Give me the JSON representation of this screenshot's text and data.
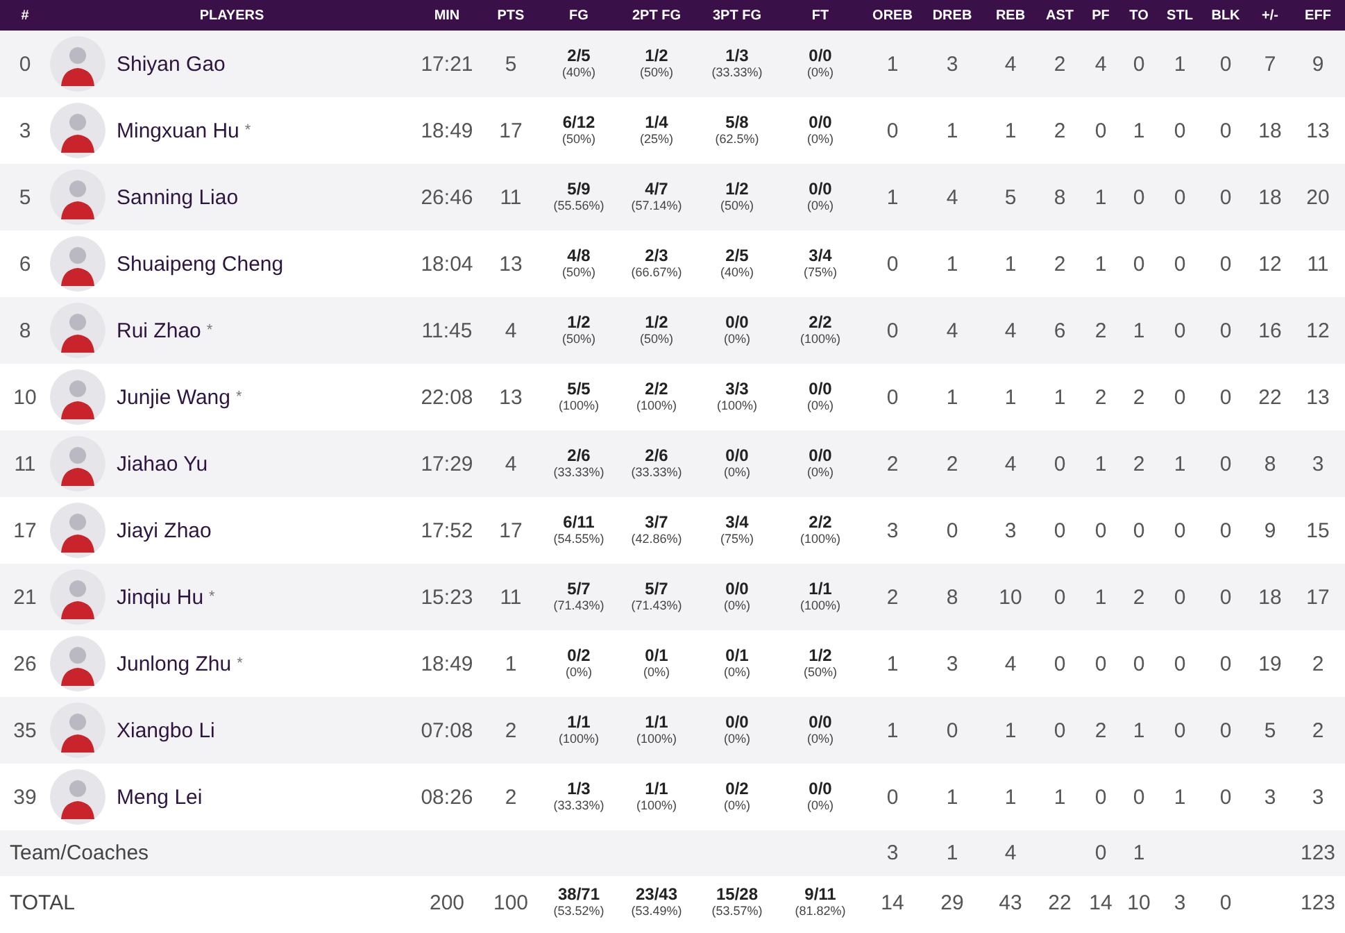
{
  "columns": [
    "#",
    "PLAYERS",
    "MIN",
    "PTS",
    "FG",
    "2PT FG",
    "3PT FG",
    "FT",
    "OREB",
    "DREB",
    "REB",
    "AST",
    "PF",
    "TO",
    "STL",
    "BLK",
    "+/-",
    "EFF"
  ],
  "players": [
    {
      "no": "0",
      "name": "Shiyan Gao",
      "min": "17:21",
      "pts": "5",
      "shots": [
        [
          "2/5",
          "(40%)"
        ],
        [
          "1/2",
          "(50%)"
        ],
        [
          "1/3",
          "(33.33%)"
        ],
        [
          "0/0",
          "(0%)"
        ]
      ],
      "stats": [
        "1",
        "3",
        "4",
        "2",
        "4",
        "0",
        "1",
        "0",
        "7",
        "9"
      ]
    },
    {
      "no": "3",
      "name": "Mingxuan Hu",
      "mark": "*",
      "min": "18:49",
      "pts": "17",
      "shots": [
        [
          "6/12",
          "(50%)"
        ],
        [
          "1/4",
          "(25%)"
        ],
        [
          "5/8",
          "(62.5%)"
        ],
        [
          "0/0",
          "(0%)"
        ]
      ],
      "stats": [
        "0",
        "1",
        "1",
        "2",
        "0",
        "1",
        "0",
        "0",
        "18",
        "13"
      ]
    },
    {
      "no": "5",
      "name": "Sanning Liao",
      "min": "26:46",
      "pts": "11",
      "shots": [
        [
          "5/9",
          "(55.56%)"
        ],
        [
          "4/7",
          "(57.14%)"
        ],
        [
          "1/2",
          "(50%)"
        ],
        [
          "0/0",
          "(0%)"
        ]
      ],
      "stats": [
        "1",
        "4",
        "5",
        "8",
        "1",
        "0",
        "0",
        "0",
        "18",
        "20"
      ]
    },
    {
      "no": "6",
      "name": "Shuaipeng Cheng",
      "min": "18:04",
      "pts": "13",
      "shots": [
        [
          "4/8",
          "(50%)"
        ],
        [
          "2/3",
          "(66.67%)"
        ],
        [
          "2/5",
          "(40%)"
        ],
        [
          "3/4",
          "(75%)"
        ]
      ],
      "stats": [
        "0",
        "1",
        "1",
        "2",
        "1",
        "0",
        "0",
        "0",
        "12",
        "11"
      ]
    },
    {
      "no": "8",
      "name": "Rui Zhao",
      "mark": "*",
      "min": "11:45",
      "pts": "4",
      "shots": [
        [
          "1/2",
          "(50%)"
        ],
        [
          "1/2",
          "(50%)"
        ],
        [
          "0/0",
          "(0%)"
        ],
        [
          "2/2",
          "(100%)"
        ]
      ],
      "stats": [
        "0",
        "4",
        "4",
        "6",
        "2",
        "1",
        "0",
        "0",
        "16",
        "12"
      ]
    },
    {
      "no": "10",
      "name": "Junjie Wang",
      "mark": "*",
      "min": "22:08",
      "pts": "13",
      "shots": [
        [
          "5/5",
          "(100%)"
        ],
        [
          "2/2",
          "(100%)"
        ],
        [
          "3/3",
          "(100%)"
        ],
        [
          "0/0",
          "(0%)"
        ]
      ],
      "stats": [
        "0",
        "1",
        "1",
        "1",
        "2",
        "2",
        "0",
        "0",
        "22",
        "13"
      ]
    },
    {
      "no": "11",
      "name": "Jiahao Yu",
      "min": "17:29",
      "pts": "4",
      "shots": [
        [
          "2/6",
          "(33.33%)"
        ],
        [
          "2/6",
          "(33.33%)"
        ],
        [
          "0/0",
          "(0%)"
        ],
        [
          "0/0",
          "(0%)"
        ]
      ],
      "stats": [
        "2",
        "2",
        "4",
        "0",
        "1",
        "2",
        "1",
        "0",
        "8",
        "3"
      ]
    },
    {
      "no": "17",
      "name": "Jiayi Zhao",
      "min": "17:52",
      "pts": "17",
      "shots": [
        [
          "6/11",
          "(54.55%)"
        ],
        [
          "3/7",
          "(42.86%)"
        ],
        [
          "3/4",
          "(75%)"
        ],
        [
          "2/2",
          "(100%)"
        ]
      ],
      "stats": [
        "3",
        "0",
        "3",
        "0",
        "0",
        "0",
        "0",
        "0",
        "9",
        "15"
      ]
    },
    {
      "no": "21",
      "name": "Jinqiu Hu",
      "mark": "*",
      "min": "15:23",
      "pts": "11",
      "shots": [
        [
          "5/7",
          "(71.43%)"
        ],
        [
          "5/7",
          "(71.43%)"
        ],
        [
          "0/0",
          "(0%)"
        ],
        [
          "1/1",
          "(100%)"
        ]
      ],
      "stats": [
        "2",
        "8",
        "10",
        "0",
        "1",
        "2",
        "0",
        "0",
        "18",
        "17"
      ]
    },
    {
      "no": "26",
      "name": "Junlong Zhu",
      "mark": "*",
      "min": "18:49",
      "pts": "1",
      "shots": [
        [
          "0/2",
          "(0%)"
        ],
        [
          "0/1",
          "(0%)"
        ],
        [
          "0/1",
          "(0%)"
        ],
        [
          "1/2",
          "(50%)"
        ]
      ],
      "stats": [
        "1",
        "3",
        "4",
        "0",
        "0",
        "0",
        "0",
        "0",
        "19",
        "2"
      ]
    },
    {
      "no": "35",
      "name": "Xiangbo Li",
      "min": "07:08",
      "pts": "2",
      "shots": [
        [
          "1/1",
          "(100%)"
        ],
        [
          "1/1",
          "(100%)"
        ],
        [
          "0/0",
          "(0%)"
        ],
        [
          "0/0",
          "(0%)"
        ]
      ],
      "stats": [
        "1",
        "0",
        "1",
        "0",
        "2",
        "1",
        "0",
        "0",
        "5",
        "2"
      ]
    },
    {
      "no": "39",
      "name": "Meng Lei",
      "min": "08:26",
      "pts": "2",
      "shots": [
        [
          "1/3",
          "(33.33%)"
        ],
        [
          "1/1",
          "(100%)"
        ],
        [
          "0/2",
          "(0%)"
        ],
        [
          "0/0",
          "(0%)"
        ]
      ],
      "stats": [
        "0",
        "1",
        "1",
        "1",
        "0",
        "0",
        "1",
        "0",
        "3",
        "3"
      ]
    }
  ],
  "team": {
    "label": "Team/Coaches",
    "stats": {
      "oreb": "3",
      "dreb": "1",
      "reb": "4",
      "pf": "0",
      "to": "1",
      "eff": "123"
    }
  },
  "total": {
    "label": "TOTAL",
    "min": "200",
    "pts": "100",
    "shots": [
      [
        "38/71",
        "(53.52%)"
      ],
      [
        "23/43",
        "(53.49%)"
      ],
      [
        "15/28",
        "(53.57%)"
      ],
      [
        "9/11",
        "(81.82%)"
      ]
    ],
    "stats": {
      "oreb": "14",
      "dreb": "29",
      "reb": "43",
      "ast": "22",
      "pf": "14",
      "to": "10",
      "stl": "3",
      "blk": "0",
      "eff": "123"
    }
  }
}
